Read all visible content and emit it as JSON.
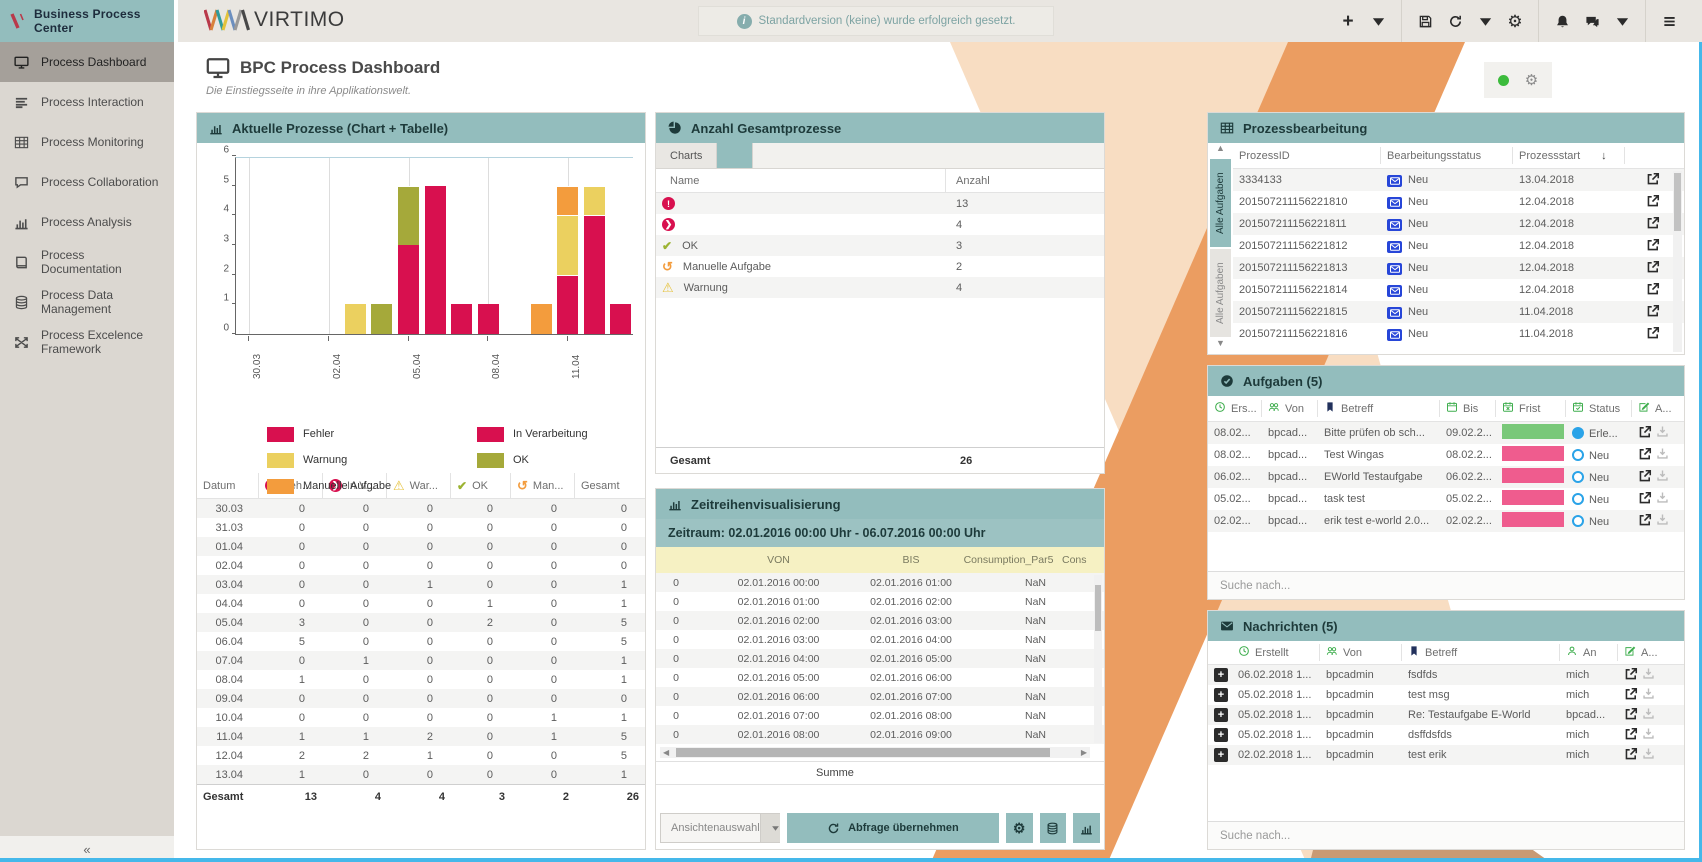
{
  "colors": {
    "teal_header": "#93bdbd",
    "teal_dark_text": "#1d3a3a",
    "crimson": "#d8104f",
    "yellow": "#ebd05f",
    "olive": "#a5a93a",
    "orange": "#f39c3d",
    "frist_green": "#79c879",
    "frist_pink": "#ef5c8e",
    "status_blue": "#2aa3e8",
    "envelope_blue": "#2746d8",
    "icon_green": "#3fae4e",
    "bookmark_navy": "#22315c",
    "bottom_line": "#45b8ea",
    "stripe_peach": "#f8ddc2",
    "stripe_orange": "#eb9d61",
    "stripe_tan": "#c99a73",
    "sidebar_bg": "#dbd7d1",
    "sidebar_active": "#a5a09a",
    "topbar_bg": "#e9e6e1",
    "thead_yellow": "#f6f1c3"
  },
  "sidebar": {
    "title": "Business Process Center",
    "collapse_glyph": "«",
    "items": [
      {
        "icon": "monitor-icon",
        "label": "Process Dashboard",
        "active": true
      },
      {
        "icon": "rows-icon",
        "label": "Process Interaction",
        "active": false
      },
      {
        "icon": "grid-icon",
        "label": "Process Monitoring",
        "active": false
      },
      {
        "icon": "chat-icon",
        "label": "Process Collaboration",
        "active": false
      },
      {
        "icon": "bar-chart-icon",
        "label": "Process Analysis",
        "active": false
      },
      {
        "icon": "book-icon",
        "label": "Process Documentation",
        "active": false
      },
      {
        "icon": "database-icon",
        "label": "Process Data Management",
        "active": false
      },
      {
        "icon": "arrows-icon",
        "label": "Process Excelence Framework",
        "active": false
      }
    ]
  },
  "topbar": {
    "logo_text": "VIRTIMO",
    "notification": "Standardversion (keine) wurde erfolgreich gesetzt.",
    "icon_groups": [
      [
        "plus-icon",
        "caret-down-icon"
      ],
      [
        "save-icon",
        "refresh-icon",
        "caret-down-icon",
        "gear-icon"
      ],
      [
        "bell-icon",
        "chat-bubble-icon",
        "caret-down-icon"
      ],
      [
        "menu-icon"
      ]
    ]
  },
  "page": {
    "title": "BPC Process Dashboard",
    "subtitle": "Die Einstiegsseite in ihre Applikationswelt.",
    "status_dot_color": "#3cbb3c"
  },
  "panels": {
    "aktuelle": {
      "title": "Aktuelle Prozesse (Chart + Tabelle)",
      "chart_data": {
        "type": "bar",
        "stacked": true,
        "categories": [
          "30.03",
          "31.03",
          "01.04",
          "02.04",
          "03.04",
          "04.04",
          "05.04",
          "06.04",
          "07.04",
          "08.04",
          "09.04",
          "10.04",
          "11.04",
          "12.04",
          "13.04"
        ],
        "series": [
          {
            "name": "Fehler",
            "color": "#d8104f",
            "values": [
              0,
              0,
              0,
              0,
              0,
              0,
              3,
              5,
              0,
              1,
              0,
              0,
              1,
              2,
              1
            ]
          },
          {
            "name": "In Verarbeitung",
            "color": "#d8104f",
            "values": [
              0,
              0,
              0,
              0,
              0,
              0,
              0,
              0,
              1,
              0,
              0,
              0,
              1,
              2,
              0
            ]
          },
          {
            "name": "Warnung",
            "color": "#ebd05f",
            "values": [
              0,
              0,
              0,
              0,
              1,
              0,
              0,
              0,
              0,
              0,
              0,
              0,
              2,
              1,
              0
            ]
          },
          {
            "name": "OK",
            "color": "#a5a93a",
            "values": [
              0,
              0,
              0,
              0,
              0,
              1,
              2,
              0,
              0,
              0,
              0,
              0,
              0,
              0,
              0
            ]
          },
          {
            "name": "Manuelle Aufgabe",
            "color": "#f39c3d",
            "values": [
              0,
              0,
              0,
              0,
              0,
              0,
              0,
              0,
              0,
              0,
              0,
              1,
              1,
              0,
              0
            ]
          }
        ],
        "ylim": [
          0,
          6
        ],
        "yticks": [
          0,
          1,
          2,
          3,
          4,
          5,
          6
        ],
        "xticks_shown": [
          "30.03",
          "02.04",
          "05.04",
          "08.04",
          "11.04"
        ],
        "grid": true,
        "legend_position": "bottom"
      },
      "legend": [
        {
          "label": "Fehler",
          "color": "#d8104f"
        },
        {
          "label": "Warnung",
          "color": "#ebd05f"
        },
        {
          "label": "Manuelle Aufgabe",
          "color": "#f39c3d"
        },
        {
          "label": "In Verarbeitung",
          "color": "#d8104f"
        },
        {
          "label": "OK",
          "color": "#a5a93a"
        }
      ],
      "table": {
        "columns": [
          {
            "icon": "",
            "label": "Datum"
          },
          {
            "icon": "error-circle-icon",
            "label": "Feh..."
          },
          {
            "icon": "forward-circle-icon",
            "label": "In V..."
          },
          {
            "icon": "warning-icon",
            "label": "War..."
          },
          {
            "icon": "check-icon",
            "label": "OK"
          },
          {
            "icon": "redo-icon",
            "label": "Man..."
          },
          {
            "icon": "",
            "label": "Gesamt"
          }
        ],
        "rows": [
          [
            "30.03",
            "0",
            "0",
            "0",
            "0",
            "0",
            "0"
          ],
          [
            "31.03",
            "0",
            "0",
            "0",
            "0",
            "0",
            "0"
          ],
          [
            "01.04",
            "0",
            "0",
            "0",
            "0",
            "0",
            "0"
          ],
          [
            "02.04",
            "0",
            "0",
            "0",
            "0",
            "0",
            "0"
          ],
          [
            "03.04",
            "0",
            "0",
            "1",
            "0",
            "0",
            "1"
          ],
          [
            "04.04",
            "0",
            "0",
            "0",
            "1",
            "0",
            "1"
          ],
          [
            "05.04",
            "3",
            "0",
            "0",
            "2",
            "0",
            "5"
          ],
          [
            "06.04",
            "5",
            "0",
            "0",
            "0",
            "0",
            "5"
          ],
          [
            "07.04",
            "0",
            "1",
            "0",
            "0",
            "0",
            "1"
          ],
          [
            "08.04",
            "1",
            "0",
            "0",
            "0",
            "0",
            "1"
          ],
          [
            "09.04",
            "0",
            "0",
            "0",
            "0",
            "0",
            "0"
          ],
          [
            "10.04",
            "0",
            "0",
            "0",
            "0",
            "1",
            "1"
          ],
          [
            "11.04",
            "1",
            "1",
            "2",
            "0",
            "1",
            "5"
          ],
          [
            "12.04",
            "2",
            "2",
            "1",
            "0",
            "0",
            "5"
          ],
          [
            "13.04",
            "1",
            "0",
            "0",
            "0",
            "0",
            "1"
          ]
        ],
        "total": [
          "Gesamt",
          "13",
          "4",
          "4",
          "3",
          "2",
          "26"
        ]
      }
    },
    "anzahl": {
      "title": "Anzahl Gesamtprozesse",
      "tab_label": "Charts",
      "columns": [
        "Name",
        "Anzahl"
      ],
      "rows": [
        {
          "icon": "error-circle-icon",
          "label": "",
          "value": "13"
        },
        {
          "icon": "forward-circle-icon",
          "label": "",
          "value": "4"
        },
        {
          "icon": "check-icon",
          "label": "OK",
          "value": "3"
        },
        {
          "icon": "redo-icon",
          "label": "Manuelle Aufgabe",
          "value": "2"
        },
        {
          "icon": "warning-icon",
          "label": "Warnung",
          "value": "4"
        }
      ],
      "total_label": "Gesamt",
      "total_value": "26"
    },
    "zeitreihen": {
      "title": "Zeitreihenvisualisierung",
      "zeitraum": "Zeitraum: 02.01.2016 00:00 Uhr - 06.07.2016 00:00 Uhr",
      "columns": [
        "",
        "VON",
        "BIS",
        "Consumption_Par5",
        "Cons"
      ],
      "rows": [
        [
          "0",
          "02.01.2016 00:00",
          "02.01.2016 01:00",
          "NaN"
        ],
        [
          "0",
          "02.01.2016 01:00",
          "02.01.2016 02:00",
          "NaN"
        ],
        [
          "0",
          "02.01.2016 02:00",
          "02.01.2016 03:00",
          "NaN"
        ],
        [
          "0",
          "02.01.2016 03:00",
          "02.01.2016 04:00",
          "NaN"
        ],
        [
          "0",
          "02.01.2016 04:00",
          "02.01.2016 05:00",
          "NaN"
        ],
        [
          "0",
          "02.01.2016 05:00",
          "02.01.2016 06:00",
          "NaN"
        ],
        [
          "0",
          "02.01.2016 06:00",
          "02.01.2016 07:00",
          "NaN"
        ],
        [
          "0",
          "02.01.2016 07:00",
          "02.01.2016 08:00",
          "NaN"
        ],
        [
          "0",
          "02.01.2016 08:00",
          "02.01.2016 09:00",
          "NaN"
        ]
      ],
      "summe_label": "Summe",
      "view_select_label": "Ansichtenauswahl",
      "apply_label": "Abfrage übernehmen",
      "footer_icons": [
        "gear-icon",
        "database-icon",
        "bar-chart-icon"
      ]
    },
    "prozessbearbeitung": {
      "title": "Prozessbearbeitung",
      "side_tabs": [
        "Alle Aufgaben",
        "Alle Aufgaben"
      ],
      "columns": [
        "ProzessID",
        "Bearbeitungsstatus",
        "Prozessstart"
      ],
      "sort_glyph": "↓",
      "rows": [
        {
          "id": "3334133",
          "status": "Neu",
          "start": "13.04.2018"
        },
        {
          "id": "201507211156221810",
          "status": "Neu",
          "start": "12.04.2018"
        },
        {
          "id": "201507211156221811",
          "status": "Neu",
          "start": "12.04.2018"
        },
        {
          "id": "201507211156221812",
          "status": "Neu",
          "start": "12.04.2018"
        },
        {
          "id": "201507211156221813",
          "status": "Neu",
          "start": "12.04.2018"
        },
        {
          "id": "201507211156221814",
          "status": "Neu",
          "start": "12.04.2018"
        },
        {
          "id": "201507211156221815",
          "status": "Neu",
          "start": "11.04.2018"
        },
        {
          "id": "201507211156221816",
          "status": "Neu",
          "start": "11.04.2018"
        }
      ]
    },
    "aufgaben": {
      "title": "Aufgaben (5)",
      "columns": [
        {
          "icon": "clock-icon",
          "label": "Ers...",
          "color": "green"
        },
        {
          "icon": "people-icon",
          "label": "Von",
          "color": "green"
        },
        {
          "icon": "bookmark-icon",
          "label": "Betreff",
          "color": "navy"
        },
        {
          "icon": "calendar-icon",
          "label": "Bis",
          "color": "green"
        },
        {
          "icon": "calendar-x-icon",
          "label": "Frist",
          "color": "green"
        },
        {
          "icon": "calendar-check-icon",
          "label": "Status",
          "color": "green"
        },
        {
          "icon": "edit-icon",
          "label": "A...",
          "color": "green"
        }
      ],
      "rows": [
        {
          "erstellt": "08.02...",
          "von": "bpcad...",
          "betreff": "Bitte prüfen ob sch...",
          "bis": "09.02.2...",
          "frist": "green",
          "status": "Erle...",
          "done": true
        },
        {
          "erstellt": "08.02...",
          "von": "bpcad...",
          "betreff": "Test Wingas",
          "bis": "08.02.2...",
          "frist": "pink",
          "status": "Neu",
          "done": false
        },
        {
          "erstellt": "06.02...",
          "von": "bpcad...",
          "betreff": "EWorld Testaufgabe",
          "bis": "06.02.2...",
          "frist": "pink",
          "status": "Neu",
          "done": false
        },
        {
          "erstellt": "05.02...",
          "von": "bpcad...",
          "betreff": "task test",
          "bis": "05.02.2...",
          "frist": "pink",
          "status": "Neu",
          "done": false
        },
        {
          "erstellt": "02.02...",
          "von": "bpcad...",
          "betreff": "erik test e-world 2.0...",
          "bis": "02.02.2...",
          "frist": "pink",
          "status": "Neu",
          "done": false
        }
      ],
      "search_placeholder": "Suche nach..."
    },
    "nachrichten": {
      "title": "Nachrichten (5)",
      "columns": [
        {
          "icon": "clock-icon",
          "label": "Erstellt",
          "color": "green"
        },
        {
          "icon": "people-icon",
          "label": "Von",
          "color": "green"
        },
        {
          "icon": "bookmark-icon",
          "label": "Betreff",
          "color": "navy"
        },
        {
          "icon": "person-icon",
          "label": "An",
          "color": "green"
        },
        {
          "icon": "edit-icon",
          "label": "A...",
          "color": "green"
        }
      ],
      "rows": [
        {
          "erstellt": "06.02.2018 1...",
          "von": "bpcadmin",
          "betreff": "fsdfds",
          "an": "mich"
        },
        {
          "erstellt": "05.02.2018 1...",
          "von": "bpcadmin",
          "betreff": "test msg",
          "an": "mich"
        },
        {
          "erstellt": "05.02.2018 1...",
          "von": "bpcadmin",
          "betreff": "Re: Testaufgabe E-World",
          "an": "bpcad..."
        },
        {
          "erstellt": "05.02.2018 1...",
          "von": "bpcadmin",
          "betreff": "dsffdsfds",
          "an": "mich"
        },
        {
          "erstellt": "02.02.2018 1...",
          "von": "bpcadmin",
          "betreff": "test erik",
          "an": "mich"
        }
      ],
      "search_placeholder": "Suche nach..."
    }
  }
}
